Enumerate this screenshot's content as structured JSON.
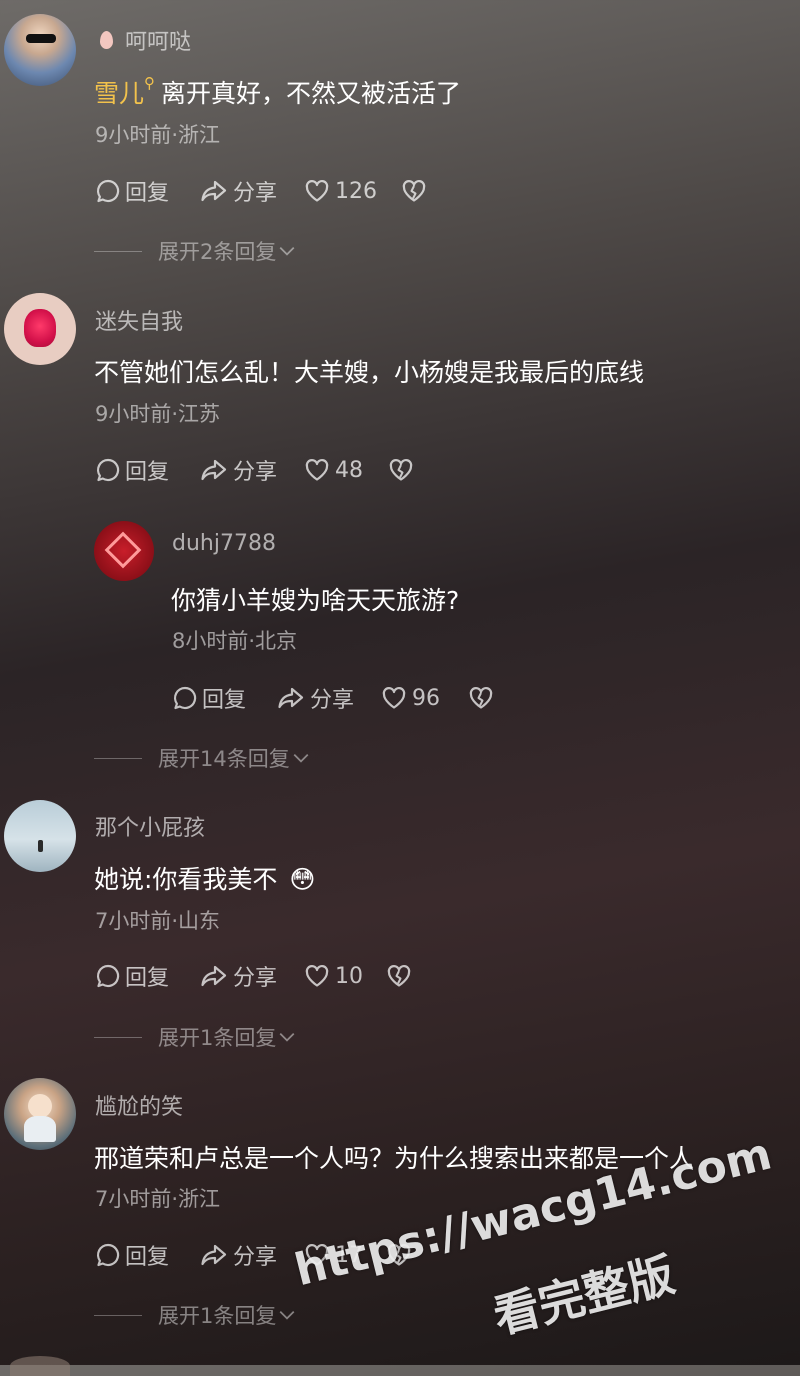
{
  "comments": [
    {
      "mention_user": "呵呵哒",
      "mention_prefix": "雪儿",
      "text": "离开真好，不然又被活活了",
      "meta": "9小时前·浙江",
      "reply_label": "回复",
      "share_label": "分享",
      "likes": "126",
      "expand": "展开2条回复"
    },
    {
      "user": "迷失自我",
      "text": "不管她们怎么乱！大羊嫂，小杨嫂是我最后的底线",
      "meta": "9小时前·江苏",
      "reply_label": "回复",
      "share_label": "分享",
      "likes": "48",
      "expand": "展开14条回复",
      "reply": {
        "user": "duhj7788",
        "text": "你猜小羊嫂为啥天天旅游?",
        "meta": "8小时前·北京",
        "reply_label": "回复",
        "share_label": "分享",
        "likes": "96"
      }
    },
    {
      "user": "那个小屁孩",
      "text": "她说:你看我美不",
      "emoji": "😳",
      "meta": "7小时前·山东",
      "reply_label": "回复",
      "share_label": "分享",
      "likes": "10",
      "expand": "展开1条回复"
    },
    {
      "user": "尴尬的笑",
      "text": "邢道荣和卢总是一个人吗？为什么搜索出来都是一个人",
      "meta": "7小时前·浙江",
      "reply_label": "回复",
      "share_label": "分享",
      "likes": "17",
      "expand": "展开1条回复"
    }
  ],
  "watermark": {
    "line1": "https://wacg14.com",
    "line2": "看完整版"
  },
  "colors": {
    "mention": "#f2c24c",
    "muted_text": "rgba(255,255,255,0.55)"
  }
}
